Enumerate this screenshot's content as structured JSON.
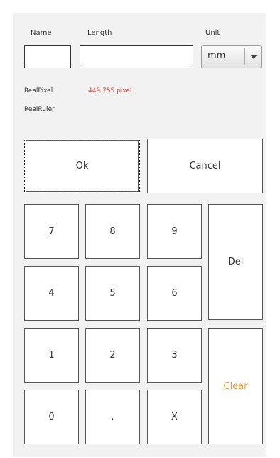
{
  "labels": {
    "name": "Name",
    "length": "Length",
    "unit": "Unit"
  },
  "inputs": {
    "name_value": "",
    "length_value": ""
  },
  "unit_select": {
    "selected": "mm",
    "icon": "chevron-down-icon"
  },
  "info": {
    "real_pixel_label": "RealPixel",
    "real_pixel_value": "449.755 pixel",
    "real_ruler_label": "RealRuler",
    "real_ruler_value": ""
  },
  "actions": {
    "ok": "Ok",
    "cancel": "Cancel"
  },
  "keypad": {
    "k7": "7",
    "k8": "8",
    "k9": "9",
    "k4": "4",
    "k5": "5",
    "k6": "6",
    "k1": "1",
    "k2": "2",
    "k3": "3",
    "k0": "0",
    "dot": ".",
    "x": "X",
    "del": "Del",
    "clear": "Clear"
  },
  "colors": {
    "panel_bg": "#f2f2f2",
    "accent_red": "#e8322b",
    "accent_orange": "#ee9a2a"
  }
}
